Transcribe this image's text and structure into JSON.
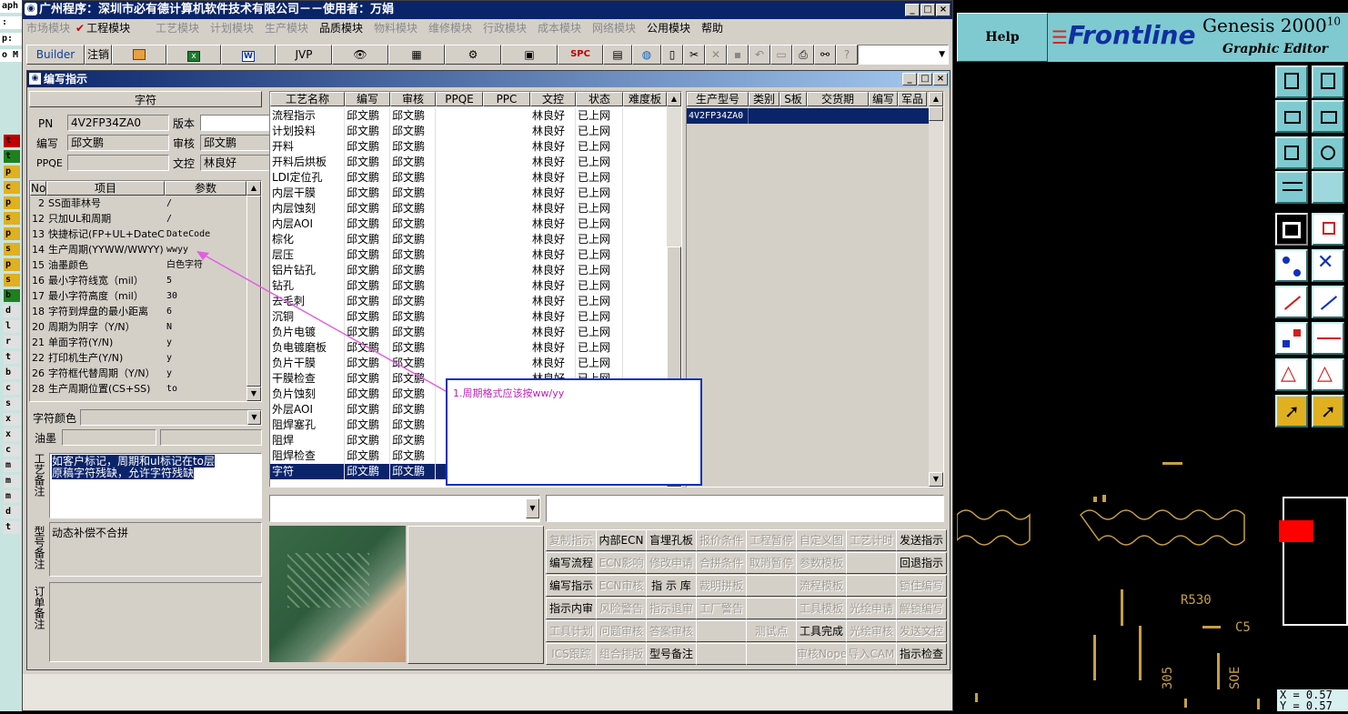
{
  "window": {
    "title": "广州程序：深圳市必有德计算机软件技术有限公司－－使用者：万娟",
    "min": "_",
    "max": "□",
    "close": "×"
  },
  "menu": [
    {
      "label": "市场模块",
      "enabled": false
    },
    {
      "label": "工程模块",
      "enabled": true,
      "checked": true
    },
    {
      "label": "工艺模块",
      "enabled": false
    },
    {
      "label": "计划模块",
      "enabled": false
    },
    {
      "label": "生产模块",
      "enabled": false
    },
    {
      "label": "品质模块",
      "enabled": true
    },
    {
      "label": "物料模块",
      "enabled": false
    },
    {
      "label": "维修模块",
      "enabled": false
    },
    {
      "label": "行政模块",
      "enabled": false
    },
    {
      "label": "成本模块",
      "enabled": false
    },
    {
      "label": "网络模块",
      "enabled": false
    },
    {
      "label": "公用模块",
      "enabled": true
    },
    {
      "label": "帮助",
      "enabled": true
    }
  ],
  "toolbar": {
    "builder": "Builder",
    "logout": "注销",
    "jvp": "JVP",
    "spc": "SPC",
    "icons": [
      "access-icon",
      "excel-icon",
      "word-icon",
      "eye-icon",
      "database-icon",
      "network-icon",
      "bitmap-icon",
      "calculator-icon",
      "globe-icon",
      "new-doc-icon",
      "cut-icon",
      "delete-icon",
      "save-icon",
      "undo-icon",
      "preview-icon",
      "print-icon",
      "find-icon",
      "help-icon"
    ]
  },
  "child": {
    "title": "编写指示"
  },
  "left": {
    "panel_title": "字符",
    "pn_label": "PN",
    "pn_value": "4V2FP34ZA0",
    "version_label": "版本",
    "version_value": "",
    "author_label": "编写",
    "author_value": "邱文鹏",
    "reviewer_label": "审核",
    "reviewer_value": "邱文鹏",
    "ppqe_label": "PPQE",
    "ppqe_value": "",
    "control_label": "文控",
    "control_value": "林良好",
    "params_headers": [
      "No",
      "项目",
      "参数"
    ],
    "params": [
      [
        "2",
        "SS面菲林号",
        "/"
      ],
      [
        "12",
        "只加UL和周期",
        "/"
      ],
      [
        "13",
        "快捷标记(FP+UL+DateCo",
        "DateCode"
      ],
      [
        "14",
        "生产周期(YYWW/WWYY)",
        "wwyy"
      ],
      [
        "15",
        "油墨颜色",
        "白色字符"
      ],
      [
        "16",
        "最小字符线宽（mil）",
        "5"
      ],
      [
        "17",
        "最小字符高度（mil）",
        "30"
      ],
      [
        "18",
        "字符到焊盘的最小距离",
        "6"
      ],
      [
        "20",
        "周期为阴字（Y/N）",
        "N"
      ],
      [
        "21",
        "单面字符(Y/N)",
        "y"
      ],
      [
        "22",
        "打印机生产(Y/N)",
        "y"
      ],
      [
        "26",
        "字符框代替周期（Y/N）",
        "y"
      ],
      [
        "28",
        "生产周期位置(CS+SS)",
        "to"
      ]
    ],
    "char_color_label": "字符颜色",
    "char_color_value": "",
    "ink_label": "油墨",
    "ink_value": "",
    "process_note_label": "工艺备注",
    "process_note": "如客户标记，周期和ul标记在to层\n原稿字符残缺，允许字符残缺",
    "type_note_label": "型号备注",
    "type_note": "动态补偿不合拼",
    "order_note_label": "订单备注",
    "order_note": ""
  },
  "process_table": {
    "headers": [
      "工艺名称",
      "编写",
      "审核",
      "PPQE",
      "PPC",
      "文控",
      "状态",
      "难度板"
    ],
    "rows": [
      [
        "流程指示",
        "邱文鹏",
        "邱文鹏",
        "",
        "",
        "林良好",
        "已上网",
        ""
      ],
      [
        "计划投料",
        "邱文鹏",
        "邱文鹏",
        "",
        "",
        "林良好",
        "已上网",
        ""
      ],
      [
        "开料",
        "邱文鹏",
        "邱文鹏",
        "",
        "",
        "林良好",
        "已上网",
        ""
      ],
      [
        "开料后烘板",
        "邱文鹏",
        "邱文鹏",
        "",
        "",
        "林良好",
        "已上网",
        ""
      ],
      [
        "LDI定位孔",
        "邱文鹏",
        "邱文鹏",
        "",
        "",
        "林良好",
        "已上网",
        ""
      ],
      [
        "内层干膜",
        "邱文鹏",
        "邱文鹏",
        "",
        "",
        "林良好",
        "已上网",
        ""
      ],
      [
        "内层蚀刻",
        "邱文鹏",
        "邱文鹏",
        "",
        "",
        "林良好",
        "已上网",
        ""
      ],
      [
        "内层AOI",
        "邱文鹏",
        "邱文鹏",
        "",
        "",
        "林良好",
        "已上网",
        ""
      ],
      [
        "棕化",
        "邱文鹏",
        "邱文鹏",
        "",
        "",
        "林良好",
        "已上网",
        ""
      ],
      [
        "层压",
        "邱文鹏",
        "邱文鹏",
        "",
        "",
        "林良好",
        "已上网",
        ""
      ],
      [
        "铝片钻孔",
        "邱文鹏",
        "邱文鹏",
        "",
        "",
        "林良好",
        "已上网",
        ""
      ],
      [
        "钻孔",
        "邱文鹏",
        "邱文鹏",
        "",
        "",
        "林良好",
        "已上网",
        ""
      ],
      [
        "去毛刺",
        "邱文鹏",
        "邱文鹏",
        "",
        "",
        "林良好",
        "已上网",
        ""
      ],
      [
        "沉铜",
        "邱文鹏",
        "邱文鹏",
        "",
        "",
        "林良好",
        "已上网",
        ""
      ],
      [
        "负片电镀",
        "邱文鹏",
        "邱文鹏",
        "",
        "",
        "林良好",
        "已上网",
        ""
      ],
      [
        "负电镀磨板",
        "邱文鹏",
        "邱文鹏",
        "",
        "",
        "林良好",
        "已上网",
        ""
      ],
      [
        "负片干膜",
        "邱文鹏",
        "邱文鹏",
        "",
        "",
        "林良好",
        "已上网",
        ""
      ],
      [
        "干膜检查",
        "邱文鹏",
        "邱文鹏",
        "",
        "",
        "林良好",
        "已上网",
        ""
      ],
      [
        "负片蚀刻",
        "邱文鹏",
        "邱文鹏",
        "",
        "",
        "",
        "",
        ""
      ],
      [
        "外层AOI",
        "邱文鹏",
        "邱文鹏",
        "",
        "",
        "",
        "",
        ""
      ],
      [
        "阻焊塞孔",
        "邱文鹏",
        "邱文鹏",
        "",
        "",
        "",
        "",
        ""
      ],
      [
        "阻焊",
        "邱文鹏",
        "邱文鹏",
        "",
        "",
        "",
        "",
        ""
      ],
      [
        "阻焊检查",
        "邱文鹏",
        "邱文鹏",
        "",
        "",
        "",
        "",
        ""
      ],
      [
        "字符",
        "邱文鹏",
        "邱文鹏",
        "",
        "",
        "",
        "",
        ""
      ]
    ],
    "selected_index": 23
  },
  "model_table": {
    "headers": [
      "生产型号",
      "类别",
      "S板",
      "交货期",
      "编写",
      "军品"
    ],
    "rows": [
      [
        "4V2FP34ZA0",
        "",
        "",
        "",
        "",
        ""
      ]
    ]
  },
  "annotation": {
    "text": "1.周期格式应该按ww/yy"
  },
  "buttons": [
    [
      {
        "t": "复制指示",
        "e": false
      },
      {
        "t": "内部ECN",
        "e": true
      },
      {
        "t": "盲埋孔板",
        "e": true
      },
      {
        "t": "报价条件",
        "e": false
      },
      {
        "t": "工程暂停",
        "e": false
      },
      {
        "t": "自定义图",
        "e": false
      },
      {
        "t": "工艺计时",
        "e": false
      },
      {
        "t": "发送指示",
        "e": true
      }
    ],
    [
      {
        "t": "编写流程",
        "e": true
      },
      {
        "t": "ECN影响",
        "e": false
      },
      {
        "t": "修改申请",
        "e": false
      },
      {
        "t": "合拼条件",
        "e": false
      },
      {
        "t": "取消暂停",
        "e": false
      },
      {
        "t": "参数模板",
        "e": false
      },
      {
        "t": "",
        "e": false
      },
      {
        "t": "回退指示",
        "e": true
      }
    ],
    [
      {
        "t": "编写指示",
        "e": true
      },
      {
        "t": "ECN审核",
        "e": false
      },
      {
        "t": "指 示 库",
        "e": true
      },
      {
        "t": "裁明拼板",
        "e": false
      },
      {
        "t": "",
        "e": false
      },
      {
        "t": "流程模板",
        "e": false
      },
      {
        "t": "",
        "e": false
      },
      {
        "t": "锁住编写",
        "e": false
      }
    ],
    [
      {
        "t": "指示内审",
        "e": true
      },
      {
        "t": "风险警告",
        "e": false
      },
      {
        "t": "指示退审",
        "e": false
      },
      {
        "t": "工厂警告",
        "e": false
      },
      {
        "t": "",
        "e": false
      },
      {
        "t": "工具模板",
        "e": false
      },
      {
        "t": "光绘申请",
        "e": false
      },
      {
        "t": "解锁编写",
        "e": false
      }
    ],
    [
      {
        "t": "工具计划",
        "e": false
      },
      {
        "t": "问题审核",
        "e": false
      },
      {
        "t": "答案审核",
        "e": false
      },
      {
        "t": "",
        "e": false
      },
      {
        "t": "测试点",
        "e": false
      },
      {
        "t": "工具完成",
        "e": true
      },
      {
        "t": "光绘审核",
        "e": false
      },
      {
        "t": "发送文控",
        "e": false
      }
    ],
    [
      {
        "t": "ICS跟踪",
        "e": false
      },
      {
        "t": "组合排版",
        "e": false
      },
      {
        "t": "型号备注",
        "e": true
      },
      {
        "t": "",
        "e": false
      },
      {
        "t": "",
        "e": false
      },
      {
        "t": "审核Nope",
        "e": false
      },
      {
        "t": "导入CAM",
        "e": false
      },
      {
        "t": "指示检查",
        "e": true
      }
    ]
  ],
  "left_strip": [
    "t",
    "t",
    "p",
    "c",
    "p",
    "s",
    "p",
    "s",
    "p",
    "s",
    "b",
    "d",
    "l",
    "r",
    "t",
    "b",
    "c",
    "s",
    "x",
    "x",
    "c",
    "m",
    "m",
    "m",
    "d",
    "t"
  ],
  "left_strip_top": [
    "aph",
    ":",
    "p:",
    "o M"
  ],
  "genesis": {
    "help": "Help",
    "brand": "Frontline",
    "product": "Genesis 2000",
    "version_sup": "10",
    "subtitle": "Graphic Editor",
    "coord": "X = 0.57",
    "coord2": "Y = 0.57",
    "labels": [
      "R530",
      "C5",
      "305",
      "SOE"
    ]
  },
  "colors": {
    "accent": "#0a246a",
    "select": "#0a246a",
    "annotation": "#e060e0",
    "genesis_bg": "#7ecad0"
  }
}
